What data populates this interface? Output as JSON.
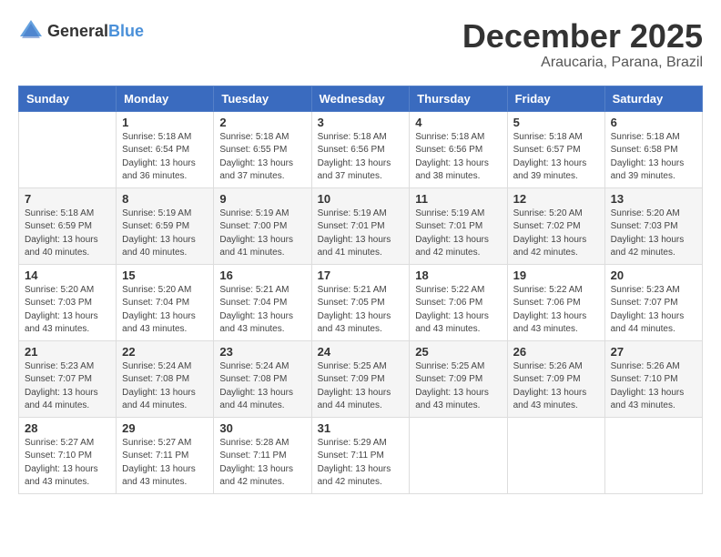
{
  "header": {
    "logo_general": "General",
    "logo_blue": "Blue",
    "month": "December 2025",
    "location": "Araucaria, Parana, Brazil"
  },
  "days_of_week": [
    "Sunday",
    "Monday",
    "Tuesday",
    "Wednesday",
    "Thursday",
    "Friday",
    "Saturday"
  ],
  "weeks": [
    [
      {
        "day": "",
        "info": ""
      },
      {
        "day": "1",
        "info": "Sunrise: 5:18 AM\nSunset: 6:54 PM\nDaylight: 13 hours\nand 36 minutes."
      },
      {
        "day": "2",
        "info": "Sunrise: 5:18 AM\nSunset: 6:55 PM\nDaylight: 13 hours\nand 37 minutes."
      },
      {
        "day": "3",
        "info": "Sunrise: 5:18 AM\nSunset: 6:56 PM\nDaylight: 13 hours\nand 37 minutes."
      },
      {
        "day": "4",
        "info": "Sunrise: 5:18 AM\nSunset: 6:56 PM\nDaylight: 13 hours\nand 38 minutes."
      },
      {
        "day": "5",
        "info": "Sunrise: 5:18 AM\nSunset: 6:57 PM\nDaylight: 13 hours\nand 39 minutes."
      },
      {
        "day": "6",
        "info": "Sunrise: 5:18 AM\nSunset: 6:58 PM\nDaylight: 13 hours\nand 39 minutes."
      }
    ],
    [
      {
        "day": "7",
        "info": "Sunrise: 5:18 AM\nSunset: 6:59 PM\nDaylight: 13 hours\nand 40 minutes."
      },
      {
        "day": "8",
        "info": "Sunrise: 5:19 AM\nSunset: 6:59 PM\nDaylight: 13 hours\nand 40 minutes."
      },
      {
        "day": "9",
        "info": "Sunrise: 5:19 AM\nSunset: 7:00 PM\nDaylight: 13 hours\nand 41 minutes."
      },
      {
        "day": "10",
        "info": "Sunrise: 5:19 AM\nSunset: 7:01 PM\nDaylight: 13 hours\nand 41 minutes."
      },
      {
        "day": "11",
        "info": "Sunrise: 5:19 AM\nSunset: 7:01 PM\nDaylight: 13 hours\nand 42 minutes."
      },
      {
        "day": "12",
        "info": "Sunrise: 5:20 AM\nSunset: 7:02 PM\nDaylight: 13 hours\nand 42 minutes."
      },
      {
        "day": "13",
        "info": "Sunrise: 5:20 AM\nSunset: 7:03 PM\nDaylight: 13 hours\nand 42 minutes."
      }
    ],
    [
      {
        "day": "14",
        "info": "Sunrise: 5:20 AM\nSunset: 7:03 PM\nDaylight: 13 hours\nand 43 minutes."
      },
      {
        "day": "15",
        "info": "Sunrise: 5:20 AM\nSunset: 7:04 PM\nDaylight: 13 hours\nand 43 minutes."
      },
      {
        "day": "16",
        "info": "Sunrise: 5:21 AM\nSunset: 7:04 PM\nDaylight: 13 hours\nand 43 minutes."
      },
      {
        "day": "17",
        "info": "Sunrise: 5:21 AM\nSunset: 7:05 PM\nDaylight: 13 hours\nand 43 minutes."
      },
      {
        "day": "18",
        "info": "Sunrise: 5:22 AM\nSunset: 7:06 PM\nDaylight: 13 hours\nand 43 minutes."
      },
      {
        "day": "19",
        "info": "Sunrise: 5:22 AM\nSunset: 7:06 PM\nDaylight: 13 hours\nand 43 minutes."
      },
      {
        "day": "20",
        "info": "Sunrise: 5:23 AM\nSunset: 7:07 PM\nDaylight: 13 hours\nand 44 minutes."
      }
    ],
    [
      {
        "day": "21",
        "info": "Sunrise: 5:23 AM\nSunset: 7:07 PM\nDaylight: 13 hours\nand 44 minutes."
      },
      {
        "day": "22",
        "info": "Sunrise: 5:24 AM\nSunset: 7:08 PM\nDaylight: 13 hours\nand 44 minutes."
      },
      {
        "day": "23",
        "info": "Sunrise: 5:24 AM\nSunset: 7:08 PM\nDaylight: 13 hours\nand 44 minutes."
      },
      {
        "day": "24",
        "info": "Sunrise: 5:25 AM\nSunset: 7:09 PM\nDaylight: 13 hours\nand 44 minutes."
      },
      {
        "day": "25",
        "info": "Sunrise: 5:25 AM\nSunset: 7:09 PM\nDaylight: 13 hours\nand 43 minutes."
      },
      {
        "day": "26",
        "info": "Sunrise: 5:26 AM\nSunset: 7:09 PM\nDaylight: 13 hours\nand 43 minutes."
      },
      {
        "day": "27",
        "info": "Sunrise: 5:26 AM\nSunset: 7:10 PM\nDaylight: 13 hours\nand 43 minutes."
      }
    ],
    [
      {
        "day": "28",
        "info": "Sunrise: 5:27 AM\nSunset: 7:10 PM\nDaylight: 13 hours\nand 43 minutes."
      },
      {
        "day": "29",
        "info": "Sunrise: 5:27 AM\nSunset: 7:11 PM\nDaylight: 13 hours\nand 43 minutes."
      },
      {
        "day": "30",
        "info": "Sunrise: 5:28 AM\nSunset: 7:11 PM\nDaylight: 13 hours\nand 42 minutes."
      },
      {
        "day": "31",
        "info": "Sunrise: 5:29 AM\nSunset: 7:11 PM\nDaylight: 13 hours\nand 42 minutes."
      },
      {
        "day": "",
        "info": ""
      },
      {
        "day": "",
        "info": ""
      },
      {
        "day": "",
        "info": ""
      }
    ]
  ]
}
